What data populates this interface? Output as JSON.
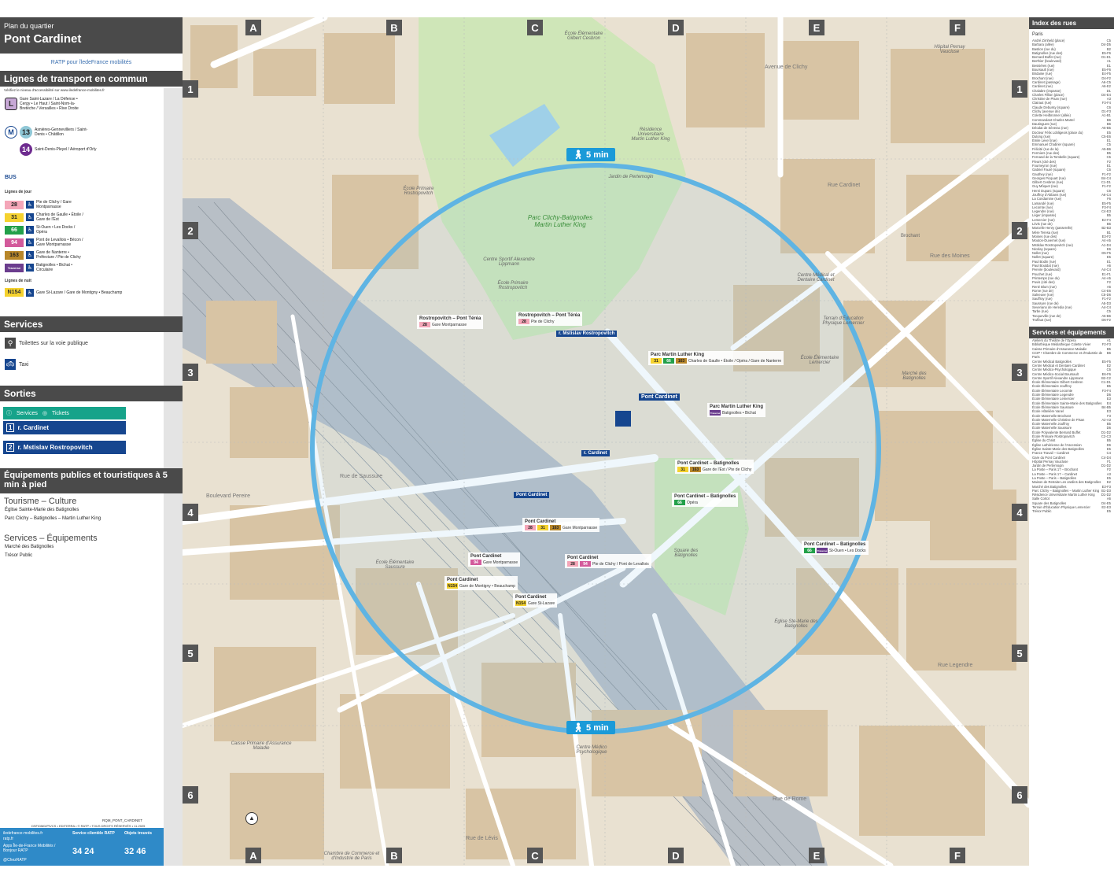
{
  "header": {
    "sub": "Plan du quartier",
    "title": "Pont Cardinet",
    "partners": "RATP pour îledeFrance mobilités"
  },
  "sections": {
    "transport": "Lignes de transport en commun",
    "services": "Services",
    "sorties": "Sorties",
    "equipements": "Équipements publics et touristiques à 5 min à pied"
  },
  "transport": {
    "note": "Vérifiez le niveau d'accessibilité sur www.iledefrance-mobilites.fr",
    "rer_l": {
      "badge": "L",
      "dest": "Gare Saint-Lazare / La Défense • Cergy • Le Haut / Saint-Nom-la-Bretèche / Versailles • Rive Droite"
    },
    "metro13": {
      "badge": "13",
      "dest": "Asnières-Gennevilliers / Saint-Denis • Châtillon"
    },
    "metro14": {
      "badge": "14",
      "dest": "Saint-Denis-Pleyel / Aéroport d'Orly"
    },
    "bus_title": "BUS",
    "day_title": "Lignes de jour",
    "night_title": "Lignes de nuit",
    "bus": [
      {
        "n": "28",
        "bg": "#f4a6b8",
        "fg": "#222",
        "d": "Pte de Clichy / Gare Montparnasse"
      },
      {
        "n": "31",
        "bg": "#f5d22e",
        "fg": "#222",
        "d": "Charles de Gaulle • Étoile / Gare de l'Est"
      },
      {
        "n": "66",
        "bg": "#23a04a",
        "fg": "#fff",
        "d": "St-Ouen • Les Docks / Opéra"
      },
      {
        "n": "94",
        "bg": "#d35a9b",
        "fg": "#fff",
        "d": "Pont de Levallois • Bécon / Gare Montparnasse"
      },
      {
        "n": "163",
        "bg": "#b8872a",
        "fg": "#222",
        "d": "Gare de Nanterre • Préfecture / Pte de Clichy"
      },
      {
        "n": "Traverse",
        "bg": "#6b3d8e",
        "fg": "#fff",
        "d": "Batignolles • Bichat • Circulaire"
      }
    ],
    "night": {
      "n": "N154",
      "bg": "#f5d22e",
      "fg": "#222",
      "d": "Gare St-Lazare / Gare de Montigny • Beauchamp"
    }
  },
  "services": [
    {
      "label": "Toilettes sur la voie publique",
      "icon": "toilet-icon"
    },
    {
      "label": "Taxi",
      "icon": "taxi-icon"
    }
  ],
  "sorties": {
    "top": {
      "services": "Services",
      "tickets": "Tickets"
    },
    "exits": [
      {
        "n": "1",
        "label": "r. Cardinet"
      },
      {
        "n": "2",
        "label": "r. Mstislav Rostropovitch"
      }
    ]
  },
  "poi": {
    "cat1": "Tourisme – Culture",
    "cat1_items": [
      "Église Sainte-Marie des Batignolles",
      "Parc Clichy – Batignolles – Martin Luther King"
    ],
    "cat2": "Services – Équipements",
    "cat2_items": [
      "Marché des Batignolles",
      "Trésor Public"
    ]
  },
  "footer": {
    "ref": "RQM_PONT_CARDINET",
    "copyright": "DSF/DMD/PIVCS • EDITERRA • © RATP • TOUS DROITS RÉSERVÉS • 11.2025",
    "web1": "iledefrance-mobilites.fr",
    "web2": "ratp.fr",
    "app": "Apps Île-de-France Mobilités / Bonjour RATP",
    "social": "@ChezRATP",
    "svc_title": "Service clientèle RATP",
    "svc_phone": "34 24",
    "lost_title": "Objets trouvés",
    "lost_phone": "32 46"
  },
  "map": {
    "columns": [
      "A",
      "B",
      "C",
      "D",
      "E",
      "F"
    ],
    "rows": [
      "1",
      "2",
      "3",
      "4",
      "5",
      "6"
    ],
    "walk": "5 min",
    "station": "Pont Cardinet",
    "stops": [
      {
        "name": "Rostropovitch – Pont Téréa",
        "lines": [
          "28"
        ],
        "d": "Gare Montparnasse"
      },
      {
        "name": "Rostropovitch – Pont Téréa",
        "lines": [
          "28"
        ],
        "d": "Pte de Clichy"
      },
      {
        "name": "Parc Martin Luther King",
        "lines": [
          "31",
          "66",
          "163"
        ],
        "d": "Charles de Gaulle • Étoile / Opéra / Gare de Nanterre"
      },
      {
        "name": "Parc Martin Luther King",
        "lines": [
          "Traverse"
        ],
        "d": "Batignolles • Bichat"
      },
      {
        "name": "Pont Cardinet – Batignolles",
        "lines": [
          "31",
          "163"
        ],
        "d": "Gare de l'Est / Pte de Clichy"
      },
      {
        "name": "Pont Cardinet – Batignolles",
        "lines": [
          "66"
        ],
        "d": "Opéra"
      },
      {
        "name": "Pont Cardinet – Batignolles",
        "lines": [
          "66",
          "Traverse"
        ],
        "d": "St-Ouen • Les Docks"
      },
      {
        "name": "Pont Cardinet",
        "lines": [
          "28",
          "31",
          "163"
        ],
        "d": "Gare Montparnasse"
      },
      {
        "name": "Pont Cardinet",
        "lines": [
          "28",
          "94"
        ],
        "d": "Pte de Clichy / Pont de Levallois"
      },
      {
        "name": "Pont Cardinet",
        "lines": [
          "94"
        ],
        "d": "Gare Montparnasse"
      },
      {
        "name": "Pont Cardinet",
        "lines": [
          "N154"
        ],
        "d": "Gare de Montigny • Beauchamp"
      },
      {
        "name": "Pont Cardinet",
        "lines": [
          "N154"
        ],
        "d": "Gare St-Lazare"
      }
    ],
    "exit1": "r. Mstislav Rostropovitch",
    "exit2": "r. Cardinet",
    "park": "Parc Clichy-Batignolles Martin Luther King",
    "places": [
      "Centre Sportif Alexandre Lippmann",
      "École Primaire Rostropovitch",
      "Centre Médical et Dentaire Cardinet",
      "Terrain d'Éducation Physique Lemercier",
      "École Élémentaire Lemercier",
      "Square des Batignolles",
      "École Élémentaire Saussure",
      "Église Ste-Marie des Batignolles",
      "École Primaire Rostropovitch",
      "Jardin de Pertemogin",
      "Résidence Universitaire Martin Luther King",
      "Brochant",
      "Marché des Batignolles",
      "Hôpital Pernay Vaucluse",
      "École Élémentaire Gilbert Cesbron",
      "Caisse Primaire d'Assurance Maladie",
      "Centre Médico Psychologique",
      "Chambre de Commerce et d'Industrie de Paris"
    ],
    "streets": [
      "Boulevard Pereire",
      "Rue de Rome",
      "Rue Cardinet",
      "Rue Legendre",
      "Rue des Moines",
      "Avenue de Clichy",
      "Rue de Saussure",
      "Rue de Lévis"
    ]
  },
  "index": {
    "title": "Index des rues",
    "city": "Paris",
    "streets": [
      [
        "André Zirnheld (place)",
        "C5"
      ],
      [
        "Barbara (allée)",
        "D4-D5"
      ],
      [
        "Bastion (rue du)",
        "B2"
      ],
      [
        "Batignolles (rue des)",
        "E5-F6"
      ],
      [
        "Bernard Buffet (rue)",
        "D1-E1"
      ],
      [
        "Berthier (boulevard)",
        "A1"
      ],
      [
        "Bessières (rue)",
        "E1"
      ],
      [
        "Boursault (rue)",
        "E5-F6"
      ],
      [
        "Bridaine (rue)",
        "E4-F5"
      ],
      [
        "Brochant (rue)",
        "D4-F2"
      ],
      [
        "Cardinet (passage)",
        "A6-C5"
      ],
      [
        "Cardinet (rue)",
        "A6-E2"
      ],
      [
        "Chalabre (impasse)",
        "D1"
      ],
      [
        "Charles Fillion (place)",
        "D4-E4"
      ],
      [
        "Christine de Pisan (rue)",
        "A3"
      ],
      [
        "Clairaut (rue)",
        "F3-F4"
      ],
      [
        "Claude Debussy (square)",
        "C6"
      ],
      [
        "Clichy (avenue de)",
        "D1-F3"
      ],
      [
        "Colette Heilbronner (allée)",
        "A1-B1"
      ],
      [
        "Commandant Charles Martel",
        "B6"
      ],
      [
        "Dautingues (rue)",
        "B6"
      ],
      [
        "Déodat de Séverac (rue)",
        "A6-B5"
      ],
      [
        "Docteur Félix Lobligeois (place du)",
        "E5"
      ],
      [
        "Dulong (rue)",
        "C5-E6"
      ],
      [
        "Émile Level (rue)",
        "E1"
      ],
      [
        "Emmanuel Chabrier (square)",
        "C5"
      ],
      [
        "Félicité (rue de la)",
        "A5-B6"
      ],
      [
        "Fermiers (rue des)",
        "B5"
      ],
      [
        "Fernand de la Tombelle (square)",
        "C5"
      ],
      [
        "Fleurs (cité des)",
        "F2"
      ],
      [
        "Fourneyron (rue)",
        "E1"
      ],
      [
        "Gabriel Fauré (square)",
        "C6"
      ],
      [
        "Gauthey (rue)",
        "F1-F2"
      ],
      [
        "Georges Picquart (rue)",
        "B4-C4"
      ],
      [
        "Gilbert Cesbron (rue)",
        "C1-D1"
      ],
      [
        "Guy Môquet (rue)",
        "F1-F2"
      ],
      [
        "Henri Duparc (square)",
        "C6"
      ],
      [
        "Jouffroy d'Abbans (rue)",
        "A6-C4"
      ],
      [
        "La Condamine (rue)",
        "F6"
      ],
      [
        "Lamandé (rue)",
        "E5-F5"
      ],
      [
        "Lecomte (rue)",
        "F3-F4"
      ],
      [
        "Legendre (rue)",
        "C4-E3"
      ],
      [
        "Léger (impasse)",
        "B5"
      ],
      [
        "Lemercier (rue)",
        "E2-F4"
      ],
      [
        "Lévis (rue de)",
        "B6"
      ],
      [
        "Marcelle Henry (passerelle)",
        "B2-B3"
      ],
      [
        "Mère Teresa (rue)",
        "B1"
      ],
      [
        "Moines (rue des)",
        "E3-F2"
      ],
      [
        "Mouton-Duvernet (rue)",
        "A4-A5"
      ],
      [
        "Mstislav Rostropovitch (rue)",
        "A1-D4"
      ],
      [
        "Nicolay (square)",
        "E6"
      ],
      [
        "Nollet (rue)",
        "D5-F5"
      ],
      [
        "Nollet (square)",
        "E5"
      ],
      [
        "Paul Bodin (rue)",
        "E1"
      ],
      [
        "Paul Bouldat (rue)",
        "A6"
      ],
      [
        "Pereire (boulevard)",
        "A4-C4"
      ],
      [
        "Pouchet (rue)",
        "E1-F1"
      ],
      [
        "Printemps (rue du)",
        "A4-A5"
      ],
      [
        "Puvis (cité des)",
        "F2"
      ],
      [
        "René Blum (rue)",
        "A6"
      ],
      [
        "Rome (rue de)",
        "C4-E6"
      ],
      [
        "Salneuve (rue)",
        "C5-D6"
      ],
      [
        "Sauffroy (rue)",
        "F1-F2"
      ],
      [
        "Saussure (rue de)",
        "A5-D3"
      ],
      [
        "Severiano de Heredia (rue)",
        "A4-C4"
      ],
      [
        "Tarbe (rue)",
        "C5"
      ],
      [
        "Tocqueville (rue de)",
        "A5-B6"
      ],
      [
        "Truffaut (rue)",
        "D6-F2"
      ]
    ],
    "svc_title": "Services et équipements",
    "svc": [
      [
        "Ateliers du Théâtre de l'Opéra",
        "A1"
      ],
      [
        "Bibliothèque Médiathèque Colette Vivier",
        "F2-F3"
      ],
      [
        "Caisse Primaire d'Assurance Maladie",
        "B5"
      ],
      [
        "CCIP • Chambre de Commerce et d'Industrie de Paris",
        "B6"
      ],
      [
        "Centre Médical Batignolles",
        "E5-F5"
      ],
      [
        "Centre Médical et Dentaire Cardinet",
        "E2"
      ],
      [
        "Centre Médico-Psychologique",
        "C6"
      ],
      [
        "Centre Médico-Social Boursault",
        "E6-F6"
      ],
      [
        "Centre Sportif Alexandre Lippmann",
        "B2-C2"
      ],
      [
        "École Élémentaire Gilbert Cesbron",
        "C1-D1"
      ],
      [
        "École Élémentaire Jouffroy",
        "B5"
      ],
      [
        "École Élémentaire Lecomte",
        "F3-F4"
      ],
      [
        "École Élémentaire Legendre",
        "D6"
      ],
      [
        "École Élémentaire Lemercier",
        "E3"
      ],
      [
        "École Élémentaire Sainte-Marie des Batignolles",
        "E4"
      ],
      [
        "École Élémentaire Saussure",
        "B4-B5"
      ],
      [
        "École Hôtelière Vanel",
        "E3"
      ],
      [
        "École Maternelle Brochant",
        "F3"
      ],
      [
        "École Maternelle Christine de Pisan",
        "A2-A3"
      ],
      [
        "École Maternelle Jouffroy",
        "B5"
      ],
      [
        "École Maternelle Saussure",
        "D6"
      ],
      [
        "École Polyvalente Bernard Buffet",
        "D1-D2"
      ],
      [
        "École Primaire Rostropovitch",
        "C2-C3"
      ],
      [
        "Église du Christ",
        "B5"
      ],
      [
        "Église Luthérienne de l'Ascension",
        "D6"
      ],
      [
        "Église Sainte-Marie des Batignolles",
        "E5"
      ],
      [
        "France Travail – Cardinet",
        "C4"
      ],
      [
        "Gare du Pont Cardinet",
        "C4-D4"
      ],
      [
        "Hôpital Pernay Vaucluse",
        "F1"
      ],
      [
        "Jardin de Pertemogin",
        "D1-D2"
      ],
      [
        "La Poste – Paris 17 – Brochant",
        "F2"
      ],
      [
        "La Poste – Paris 17 – Cardinet",
        "A3"
      ],
      [
        "La Poste – Paris – Batignolles",
        "E5"
      ],
      [
        "Maison de Retraite Les Jardins des Batignolles",
        "E2"
      ],
      [
        "Marché des Batignolles",
        "E3-F3"
      ],
      [
        "Parc Clichy – Batignolles – Martin Luther King",
        "B1-D3"
      ],
      [
        "Résidence Universitaire Martin Luther King",
        "D1-D2"
      ],
      [
        "Salle Cortot",
        "A6"
      ],
      [
        "Square des Batignolles",
        "D4-E5"
      ],
      [
        "Terrain d'Éducation Physique Lemercier",
        "E2-E3"
      ],
      [
        "Trésor Public",
        "E5"
      ]
    ]
  },
  "colors": {
    "panel_dark": "#4a4a4a",
    "ratp_blue": "#16468f",
    "walk_blue": "#1b9ad8",
    "map_bg": "#e9e1d1",
    "park": "#cfe6b8",
    "building": "#d8c4a4",
    "rail": "#9aa3ad"
  }
}
